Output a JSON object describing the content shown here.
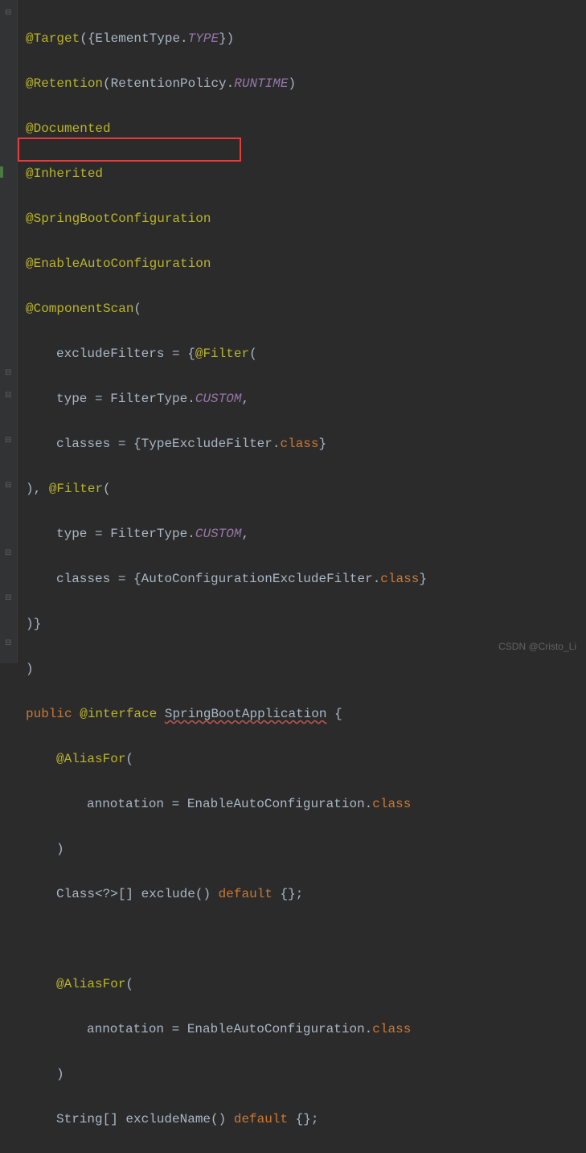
{
  "code": {
    "ann_target": "@Target",
    "target_args_open": "({",
    "elemtype": "ElementType",
    "dot": ".",
    "type_const": "TYPE",
    "target_args_close": "})",
    "ann_retention": "@Retention",
    "ret_open": "(",
    "retpolicy": "RetentionPolicy",
    "runtime": "RUNTIME",
    "ret_close": ")",
    "ann_documented": "@Documented",
    "ann_inherited": "@Inherited",
    "ann_sbconfig": "@SpringBootConfiguration",
    "ann_enableauto": "@EnableAutoConfiguration",
    "ann_compscan": "@ComponentScan",
    "open_paren": "(",
    "excludeFilters": "excludeFilters",
    "eq": " = ",
    "open_brace": "{",
    "ann_filter": "@Filter",
    "type_prop": "type",
    "filtertype": "FilterType",
    "custom": "CUSTOM",
    "comma": ",",
    "classes_prop": "classes",
    "typeexclude": "TypeExcludeFilter",
    "class_kw": "class",
    "close_brace": "}",
    "close_paren": ")",
    "autoconfexclude": "AutoConfigurationExcludeFilter",
    "close_brace_paren": ")}",
    "public_kw": "public ",
    "atinterface": "@interface ",
    "sba": "SpringBootApplication",
    "open_curly": " {",
    "ann_aliasfor": "@AliasFor",
    "annotation_prop": "annotation",
    "enableautoconfig": "EnableAutoConfiguration",
    "class_type": "Class",
    "wildcard": "<?>[]",
    "exclude_method": " exclude() ",
    "default_kw": "default",
    "empty_array": " {};",
    "string_type": "String",
    "arr": "[]",
    "excludeName_method": " excludeName() "
  },
  "watermark": "CSDN @Cristo_Li"
}
